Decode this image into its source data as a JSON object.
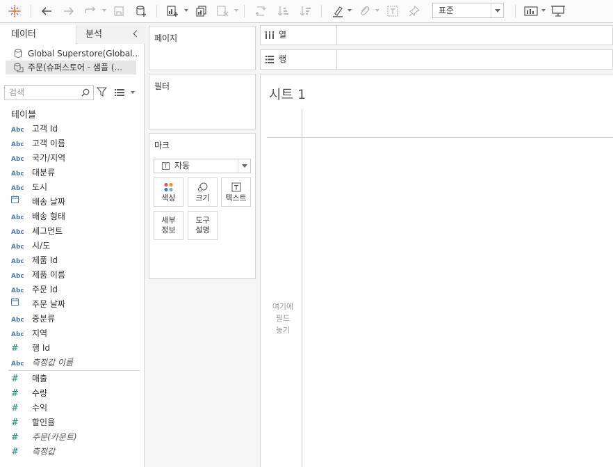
{
  "toolbar": {
    "fit_select": "표준"
  },
  "data_pane": {
    "tab_data": "데이터",
    "tab_analysis": "분석",
    "datasources": [
      "Global Superstore(Global...",
      "주문(슈퍼스토어 - 샘플 (..."
    ],
    "search_placeholder": "검색",
    "tables_heading": "테이블",
    "dimensions": [
      {
        "type": "Abc",
        "label": "고객 Id"
      },
      {
        "type": "Abc",
        "label": "고객 이름"
      },
      {
        "type": "Abc",
        "label": "국가/지역"
      },
      {
        "type": "Abc",
        "label": "대분류"
      },
      {
        "type": "Abc",
        "label": "도시"
      },
      {
        "type": "date",
        "label": "배송 날짜"
      },
      {
        "type": "Abc",
        "label": "배송 형태"
      },
      {
        "type": "Abc",
        "label": "세그먼트"
      },
      {
        "type": "Abc",
        "label": "시/도"
      },
      {
        "type": "Abc",
        "label": "제품 Id"
      },
      {
        "type": "Abc",
        "label": "제품 이름"
      },
      {
        "type": "Abc",
        "label": "주문 Id"
      },
      {
        "type": "date",
        "label": "주문 날짜"
      },
      {
        "type": "Abc",
        "label": "중분류"
      },
      {
        "type": "Abc",
        "label": "지역"
      },
      {
        "type": "#",
        "label": "행 Id"
      },
      {
        "type": "Abc",
        "label": "측정값 이름"
      }
    ],
    "measures": [
      {
        "type": "#",
        "label": "매출"
      },
      {
        "type": "#",
        "label": "수량"
      },
      {
        "type": "#",
        "label": "수익"
      },
      {
        "type": "#",
        "label": "할인율"
      },
      {
        "type": "#",
        "label": "주문(카운트)"
      },
      {
        "type": "#",
        "label": "측정값"
      }
    ]
  },
  "cards": {
    "pages": "페이지",
    "filters": "필터",
    "marks": "마크",
    "marks_type": "자동",
    "mark_buttons": {
      "color": "색상",
      "size": "크기",
      "text": "텍스트",
      "detail_1": "세부",
      "detail_2": "정보",
      "tooltip_1": "도구",
      "tooltip_2": "설명"
    }
  },
  "shelves": {
    "columns": "열",
    "rows": "행"
  },
  "view": {
    "sheet_title": "시트 1",
    "drop_hint": [
      "여기에",
      "필드",
      "놓기"
    ]
  },
  "colors": {
    "accent_blue": "#4e79a7",
    "measure_green": "#1b8f7a"
  }
}
